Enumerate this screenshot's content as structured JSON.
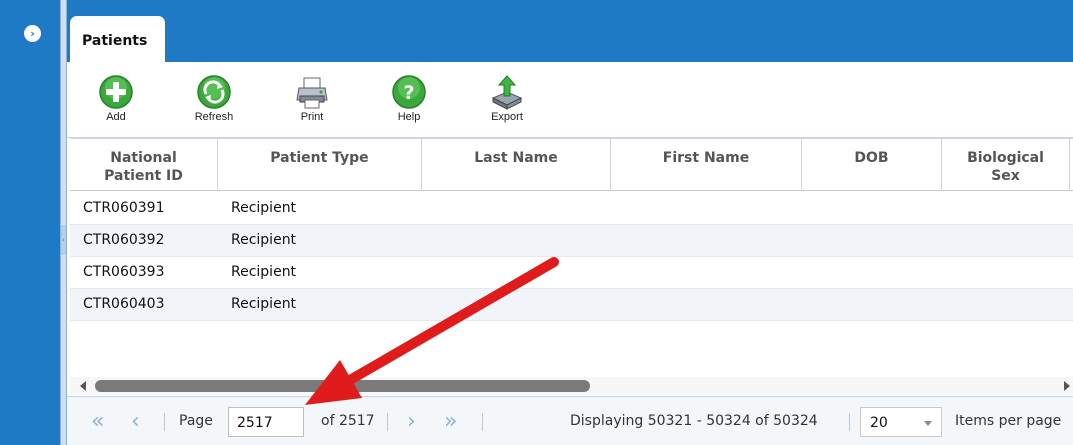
{
  "colors": {
    "accent": "#1f7ac6",
    "arrow": "#e01b1b"
  },
  "tabs": [
    {
      "label": "Patients",
      "active": true
    }
  ],
  "toolbar": {
    "buttons": [
      {
        "label": "Add",
        "icon": "add-icon"
      },
      {
        "label": "Refresh",
        "icon": "refresh-icon"
      },
      {
        "label": "Print",
        "icon": "printer-icon"
      },
      {
        "label": "Help",
        "icon": "help-icon"
      },
      {
        "label": "Export",
        "icon": "export-icon"
      }
    ]
  },
  "grid": {
    "columns": [
      {
        "line1": "National",
        "line2": "Patient ID"
      },
      {
        "line1": "Patient Type",
        "line2": ""
      },
      {
        "line1": "Last Name",
        "line2": ""
      },
      {
        "line1": "First Name",
        "line2": ""
      },
      {
        "line1": "DOB",
        "line2": ""
      },
      {
        "line1": "Biological",
        "line2": "Sex"
      }
    ],
    "rows": [
      {
        "id": "CTR060391",
        "type": "Recipient"
      },
      {
        "id": "CTR060392",
        "type": "Recipient"
      },
      {
        "id": "CTR060393",
        "type": "Recipient"
      },
      {
        "id": "CTR060403",
        "type": "Recipient"
      }
    ]
  },
  "pager": {
    "first_icon": "«",
    "prev_icon": "‹",
    "next_icon": "›",
    "last_icon": "»",
    "page_label": "Page",
    "page_value": "2517",
    "of_label": "of 2517",
    "display_text": "Displaying 50321 - 50324 of 50324",
    "page_size": "20",
    "items_per_page_label": "Items per page"
  }
}
